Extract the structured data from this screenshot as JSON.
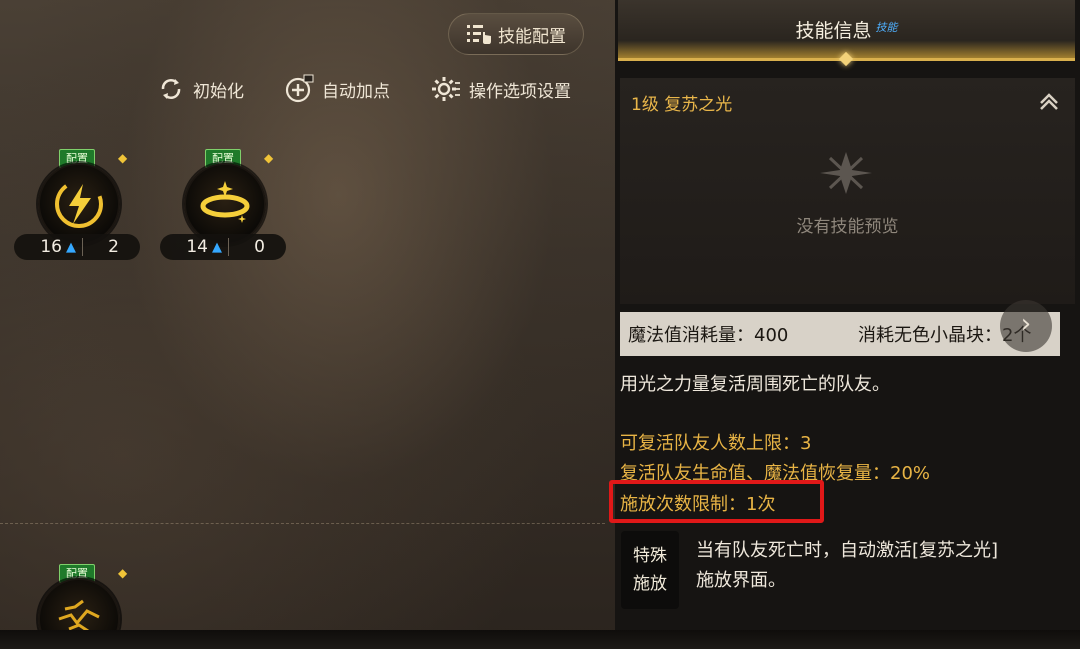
{
  "toolbar": {
    "skill_config_label": "技能配置",
    "reset_label": "初始化",
    "auto_add_label": "自动加点",
    "options_label": "操作选项设置"
  },
  "skills": [
    {
      "tag": "配置",
      "level": "16",
      "points": "2"
    },
    {
      "tag": "配置",
      "level": "14",
      "points": "0"
    },
    {
      "tag": "配置"
    }
  ],
  "panel": {
    "title": "技能信息",
    "badge": "技能",
    "skill_name": "1级 复苏之光",
    "no_preview": "没有技能预览",
    "mp_cost": "魔法值消耗量：400",
    "item_cost": "消耗无色小晶块：2个",
    "description": "用光之力量复活周围死亡的队友。",
    "attributes": [
      "可复活队友人数上限：3",
      "复活队友生命值、魔法值恢复量：20%",
      "施放次数限制：1次"
    ],
    "special_tag_line1": "特殊",
    "special_tag_line2": "施放",
    "special_text": "当有队友死亡时，自动激活[复苏之光]施放界面。"
  },
  "colors": {
    "accent_gold": "#e8b445",
    "highlight_red": "#e01818",
    "level_arrow": "#35a8ff"
  }
}
